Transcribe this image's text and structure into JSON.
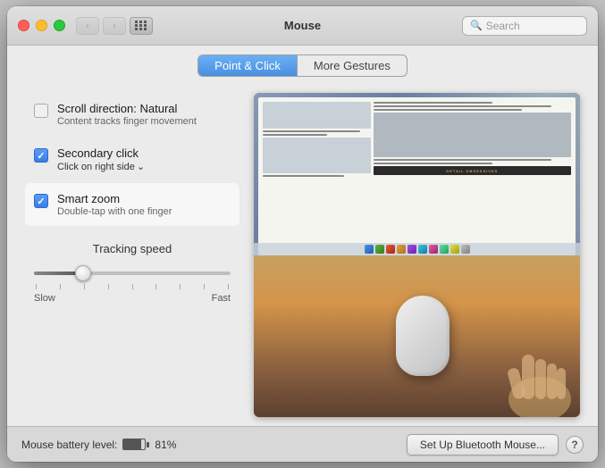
{
  "window": {
    "title": "Mouse",
    "search_placeholder": "Search"
  },
  "tabs": [
    {
      "id": "point-click",
      "label": "Point & Click",
      "active": true
    },
    {
      "id": "more-gestures",
      "label": "More Gestures",
      "active": false
    }
  ],
  "options": [
    {
      "id": "scroll-direction",
      "checked": false,
      "title": "Scroll direction: Natural",
      "subtitle": "Content tracks finger movement",
      "dropdown": null
    },
    {
      "id": "secondary-click",
      "checked": true,
      "title": "Secondary click",
      "subtitle": "Click on right side",
      "dropdown": "Click on right side"
    },
    {
      "id": "smart-zoom",
      "checked": true,
      "title": "Smart zoom",
      "subtitle": "Double-tap with one finger",
      "dropdown": null
    }
  ],
  "tracking": {
    "label": "Tracking speed",
    "slow_label": "Slow",
    "fast_label": "Fast",
    "value": 25
  },
  "bottom_bar": {
    "battery_label": "Mouse battery level:",
    "battery_percent": "81%",
    "bluetooth_button": "Set Up Bluetooth Mouse...",
    "help_icon": "?"
  }
}
